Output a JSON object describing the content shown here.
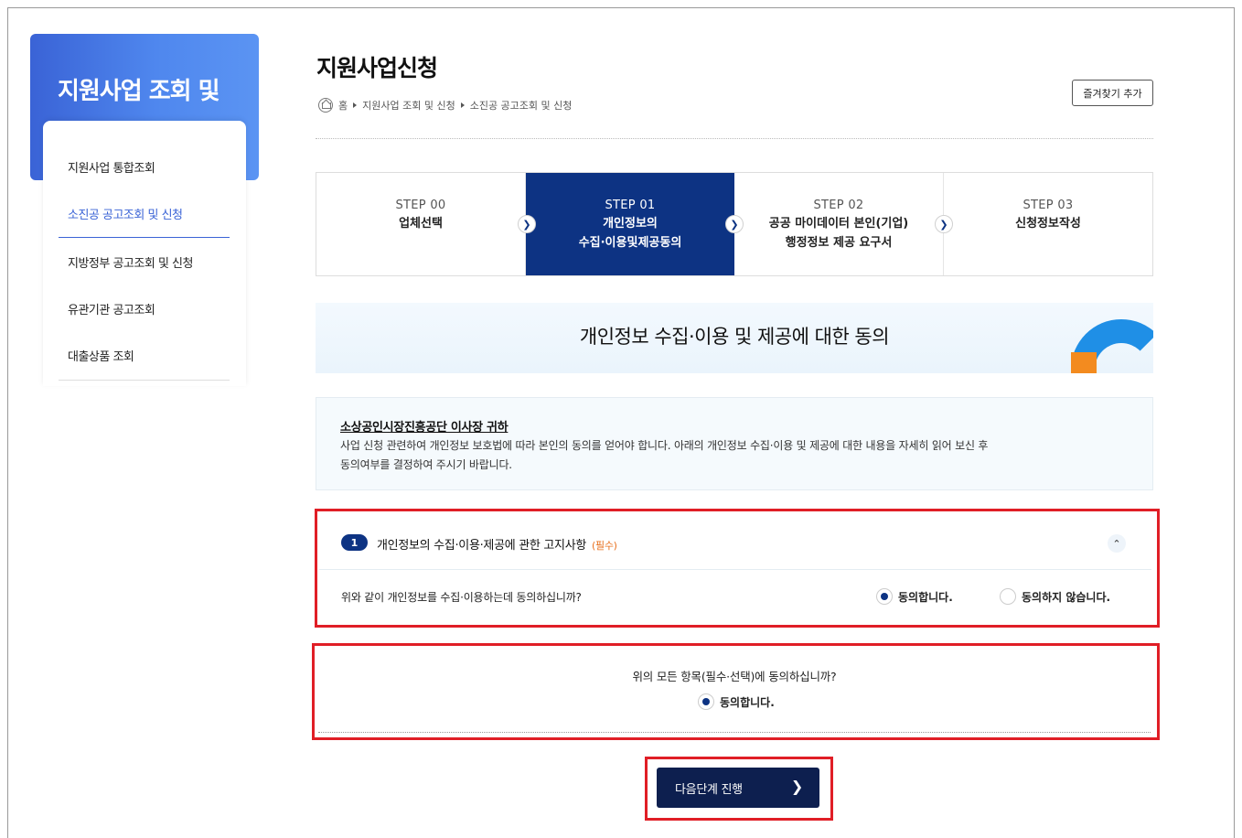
{
  "sidebar": {
    "title": "지원사업 조회 및",
    "items": [
      {
        "label": "지원사업 통합조회"
      },
      {
        "label": "소진공 공고조회 및 신청"
      },
      {
        "label": "지방정부 공고조회 및 신청"
      },
      {
        "label": "유관기관 공고조회"
      },
      {
        "label": "대출상품 조회"
      }
    ]
  },
  "header": {
    "title": "지원사업신청",
    "breadcrumb": [
      "홈",
      "지원사업 조회 및 신청",
      "소진공 공고조회 및 신청"
    ],
    "favorite_label": "즐겨찾기 추가"
  },
  "steps": [
    {
      "num": "STEP 00",
      "label": "업체선택"
    },
    {
      "num": "STEP 01",
      "label": "개인정보의\n수집·이용및제공동의"
    },
    {
      "num": "STEP 02",
      "label": "공공 마이데이터 본인(기업)\n행정정보 제공 요구서"
    },
    {
      "num": "STEP 03",
      "label": "신청정보작성"
    }
  ],
  "section": {
    "title": "개인정보 수집·이용 및 제공에 대한 동의"
  },
  "notice": {
    "heading": "소상공인시장진흥공단 이사장 귀하",
    "line1": "사업 신청 관련하여 개인정보 보호법에 따라 본인의 동의를 얻어야 합니다. 아래의 개인정보 수집·이용 및 제공에 대한 내용을 자세히 읽어 보신 후",
    "line2": "동의여부를 결정하여 주시기 바랍니다."
  },
  "item1": {
    "number": "1",
    "title": "개인정보의 수집·이용·제공에 관한 고지사항",
    "required": "(필수)",
    "question": "위와 같이 개인정보를 수집·이용하는데 동의하십니까?",
    "agree_label": "동의합니다.",
    "disagree_label": "동의하지 않습니다."
  },
  "all_agree": {
    "question": "위의 모든 항목(필수·선택)에 동의하십니까?",
    "agree_label": "동의합니다."
  },
  "next_button": {
    "label": "다음단계 진행"
  },
  "colors": {
    "primary": "#0d3383",
    "accent_blue": "#3a63d6",
    "highlight_red": "#e01e26",
    "required_orange": "#e8701e"
  }
}
